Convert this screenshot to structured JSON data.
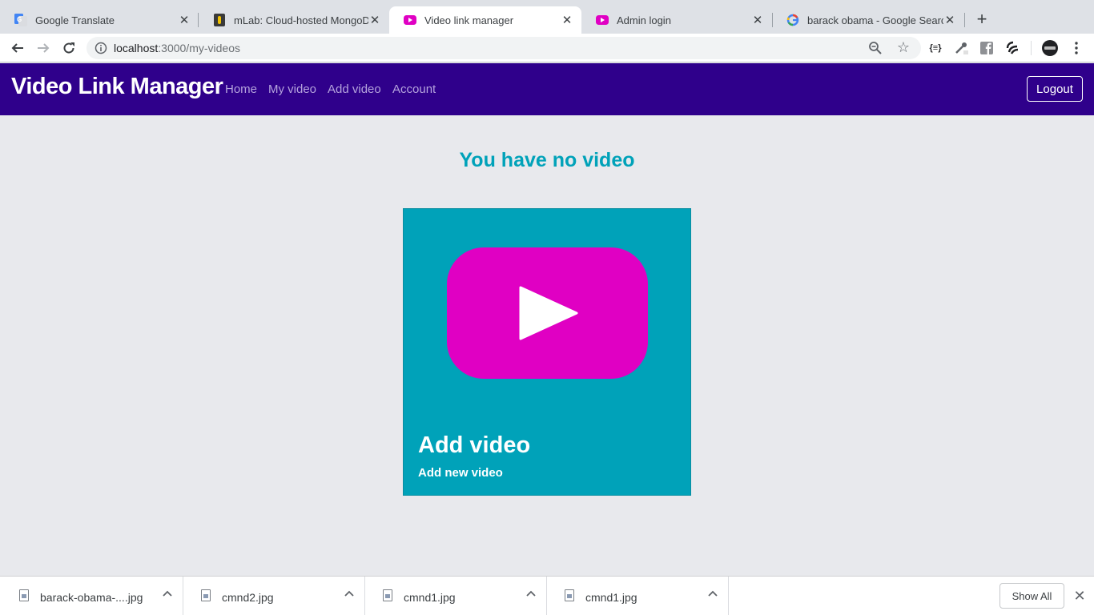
{
  "browser": {
    "tabs": [
      {
        "title": "Google Translate",
        "icon": "google-translate-icon",
        "active": false
      },
      {
        "title": "mLab: Cloud-hosted MongoDB",
        "icon": "mlab-icon",
        "active": false
      },
      {
        "title": "Video link manager",
        "icon": "video-play-icon",
        "active": true
      },
      {
        "title": "Admin login",
        "icon": "video-play-icon",
        "active": false
      },
      {
        "title": "barack obama - Google Search",
        "icon": "google-icon",
        "active": false
      }
    ],
    "new_tab_symbol": "+",
    "url_host": "localhost",
    "url_path": ":3000/my-videos"
  },
  "navbar": {
    "brand": "Video Link Manager",
    "links": [
      "Home",
      "My video",
      "Add video",
      "Account"
    ],
    "logout_label": "Logout"
  },
  "main": {
    "heading": "You have no video",
    "card": {
      "title": "Add video",
      "subtitle": "Add new video"
    }
  },
  "downloads": {
    "items": [
      "barack-obama-....jpg",
      "cmnd2.jpg",
      "cmnd1.jpg",
      "cmnd1.jpg"
    ],
    "show_all_label": "Show All"
  },
  "colors": {
    "navbar_bg": "#2f008b",
    "accent": "#00a2b9",
    "play_icon": "#e000c3",
    "page_bg": "#e8e9ed"
  }
}
